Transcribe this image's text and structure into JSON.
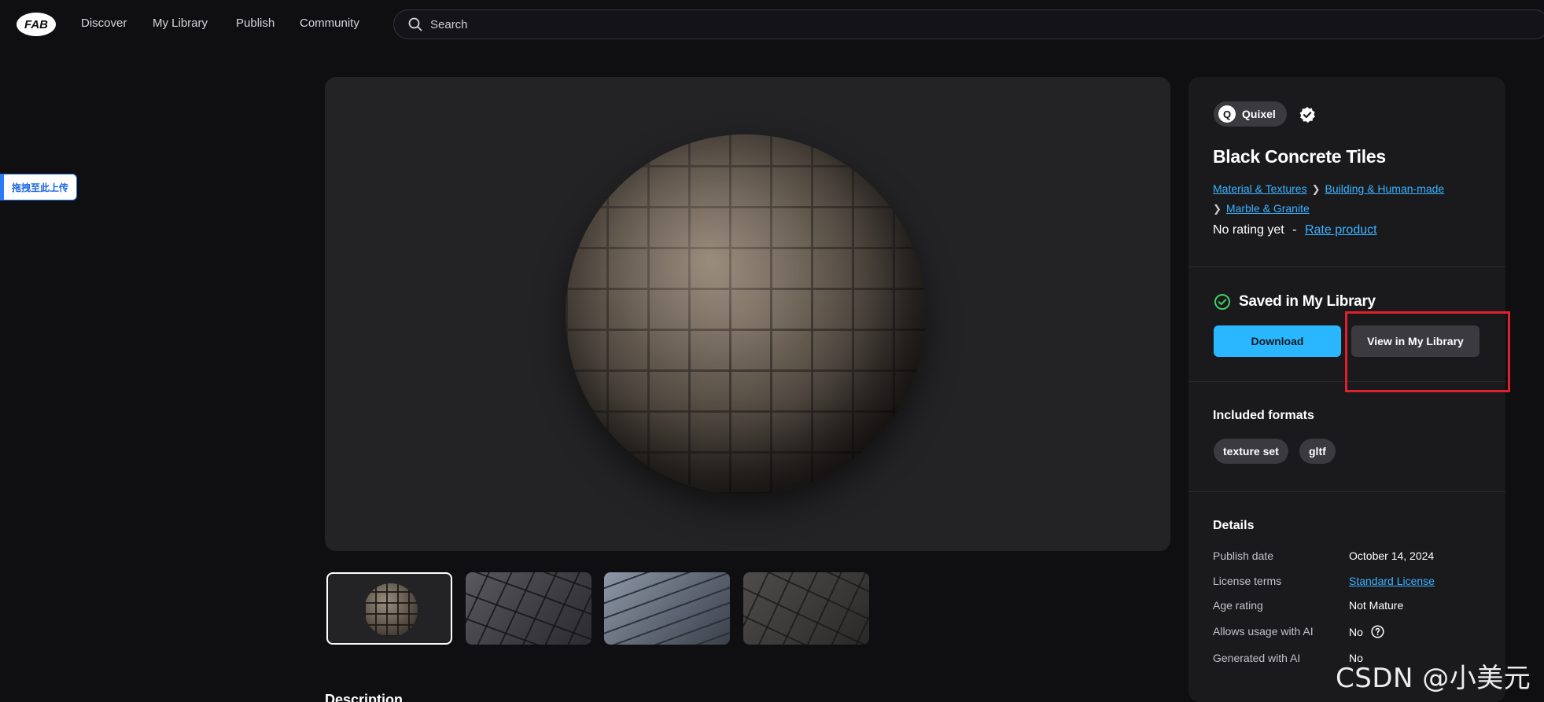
{
  "nav": {
    "items": [
      {
        "label": "Discover"
      },
      {
        "label": "My Library"
      },
      {
        "label": "Publish"
      },
      {
        "label": "Community"
      }
    ],
    "search_placeholder": "Search"
  },
  "upload_tag": "拖拽至此上传",
  "product": {
    "publisher": "Quixel",
    "publisher_initial": "Q",
    "title": "Black Concrete Tiles",
    "breadcrumbs": [
      "Material & Textures",
      "Building & Human-made",
      "Marble & Granite"
    ],
    "rating_text": "No rating yet",
    "rating_sep": "-",
    "rate_link": "Rate product"
  },
  "library": {
    "status": "Saved in My Library",
    "download_label": "Download",
    "view_label": "View in My Library"
  },
  "formats": {
    "title": "Included formats",
    "tags": [
      "texture set",
      "gltf"
    ]
  },
  "details": {
    "title": "Details",
    "rows": [
      {
        "key": "Publish date",
        "value": "October 14, 2024"
      },
      {
        "key": "License terms",
        "value": "Standard License"
      },
      {
        "key": "Age rating",
        "value": "Not Mature"
      },
      {
        "key": "Allows usage with AI",
        "value": "No"
      },
      {
        "key": "Generated with AI",
        "value": "No"
      }
    ]
  },
  "description_heading": "Description",
  "watermark": "CSDN @小美元",
  "colors": {
    "accent": "#2bb7ff",
    "link": "#3ab2ff",
    "highlight": "#e0202a",
    "success": "#3ecf5e"
  }
}
